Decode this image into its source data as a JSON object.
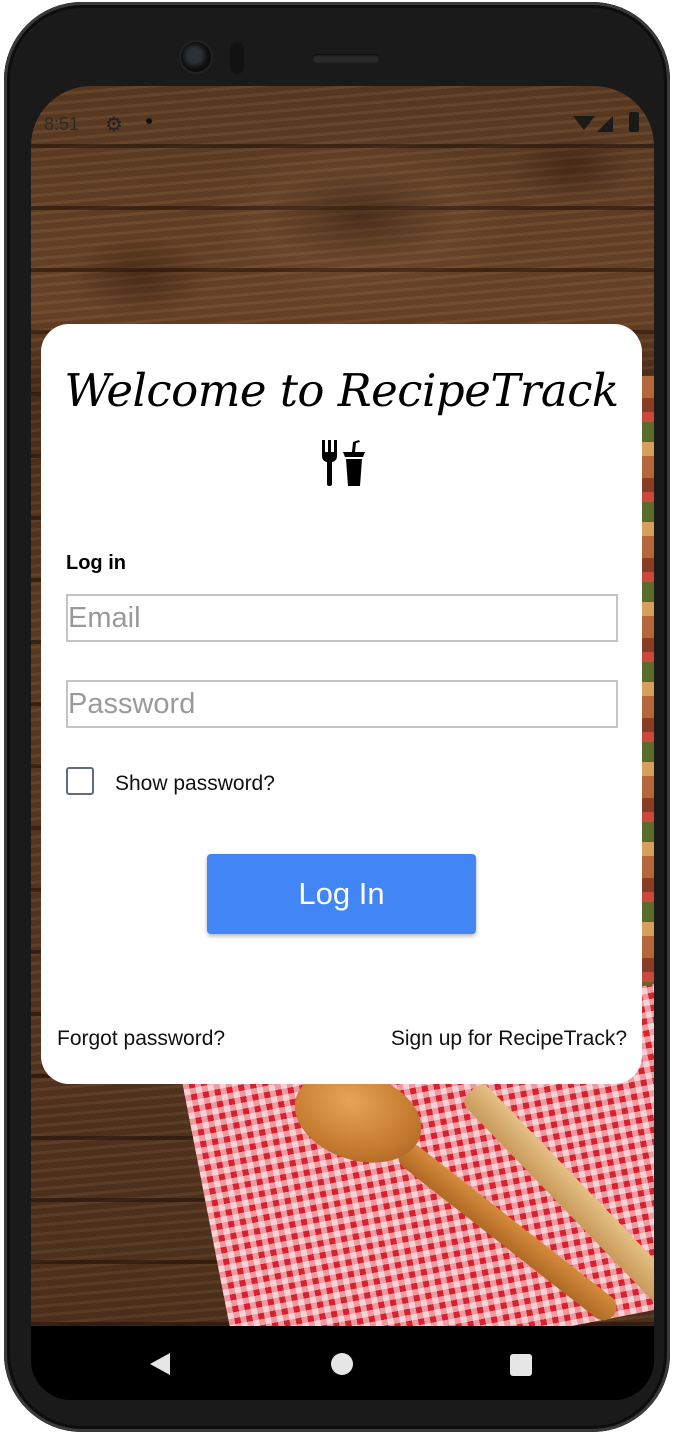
{
  "status_bar": {
    "time": "8:51",
    "icons": [
      "gear-icon",
      "dot-icon",
      "wifi-icon",
      "signal-icon",
      "battery-icon"
    ]
  },
  "login_card": {
    "welcome_title": "Welcome to RecipeTrack",
    "title_icon": "utensils-icon",
    "section_heading": "Log in",
    "email_placeholder": "Email",
    "email_value": "",
    "password_placeholder": "Password",
    "password_value": "",
    "show_password_label": "Show password?",
    "show_password_checked": false,
    "login_button_label": "Log In",
    "forgot_password_link": "Forgot password?",
    "signup_link": "Sign up for RecipeTrack?"
  },
  "nav_bar": {
    "icons": [
      "back-icon",
      "home-icon",
      "recents-icon"
    ]
  },
  "colors": {
    "primary_button": "#4285f4",
    "card_background": "#ffffff",
    "input_border": "#c4c4c4",
    "placeholder_text": "#9a9a9a"
  }
}
